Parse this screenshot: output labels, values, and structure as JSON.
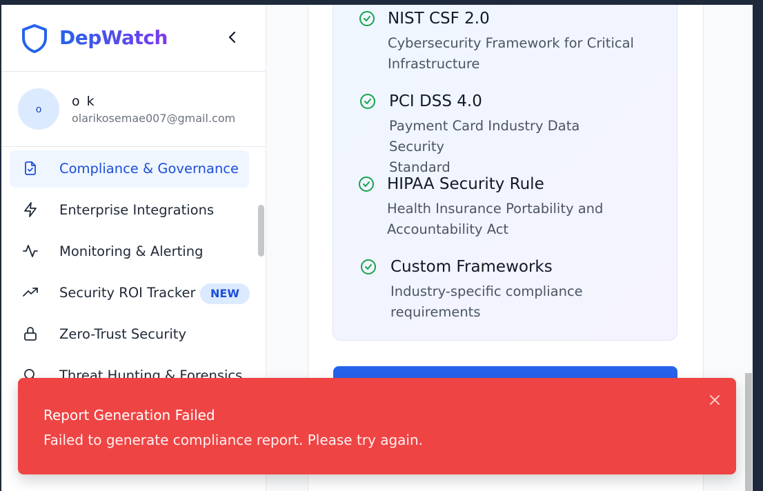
{
  "brand": {
    "title": "DepWatch",
    "logo_icon": "shield-icon",
    "collapse_icon": "chevron-left-icon"
  },
  "user": {
    "initial": "o",
    "name": "o k",
    "email": "olarikosemae007@gmail.com"
  },
  "nav": {
    "items": [
      {
        "label": "Compliance & Governance",
        "icon": "file-check-icon",
        "active": true
      },
      {
        "label": "Enterprise Integrations",
        "icon": "zap-icon"
      },
      {
        "label": "Monitoring & Alerting",
        "icon": "activity-icon"
      },
      {
        "label": "Security ROI Tracker",
        "icon": "trending-up-icon",
        "badge": "NEW"
      },
      {
        "label": "Zero-Trust Security",
        "icon": "lock-icon"
      },
      {
        "label": "Threat Hunting & Forensics",
        "icon": "search-icon"
      }
    ]
  },
  "frameworks": [
    {
      "title": "NIST CSF 2.0",
      "desc_line1": "Cybersecurity Framework for Critical",
      "desc_line2": "Infrastructure"
    },
    {
      "title": "PCI DSS 4.0",
      "desc_line1": "Payment Card Industry Data Security",
      "desc_line2": "Standard"
    },
    {
      "title": "HIPAA Security Rule",
      "desc_line1": "Health Insurance Portability and",
      "desc_line2": "Accountability Act"
    },
    {
      "title": "Custom Frameworks",
      "desc_line1": "Industry-specific compliance",
      "desc_line2": "requirements"
    }
  ],
  "toast": {
    "title": "Report Generation Failed",
    "message": "Failed to generate compliance report. Please try again.",
    "close_icon": "close-icon"
  },
  "colors": {
    "accent": "#2563eb",
    "brand_gradient_end": "#7c3aed",
    "success": "#16a34a",
    "error": "#ef4444"
  }
}
